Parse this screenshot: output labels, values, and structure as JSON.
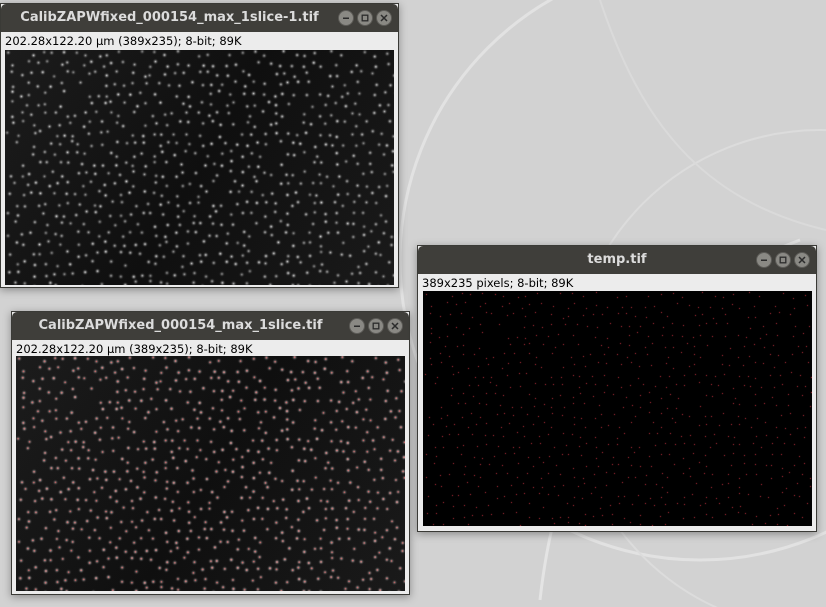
{
  "windows": [
    {
      "id": "w1",
      "title": "CalibZAPWfixed_000154_max_1slice-1.tif",
      "info": "202.28x122.20 µm (389x235); 8-bit; 89K",
      "image": "bright-spots",
      "overlay": false
    },
    {
      "id": "w2",
      "title": "CalibZAPWfixed_000154_max_1slice.tif",
      "info": "202.28x122.20 µm (389x235); 8-bit; 89K",
      "image": "bright-spots",
      "overlay": true,
      "overlay_color": "#ff6a6a"
    },
    {
      "id": "w3",
      "title": "temp.tif",
      "info": "389x235 pixels; 8-bit; 89K",
      "image": "sparse-red-points",
      "point_color": "#c0303a"
    }
  ],
  "window_controls": [
    "minimize-icon",
    "maximize-icon",
    "close-icon"
  ],
  "colors": {
    "titlebar": "#3f3e3a",
    "window_body": "#ececec",
    "desktop": "#d2d2d2"
  }
}
